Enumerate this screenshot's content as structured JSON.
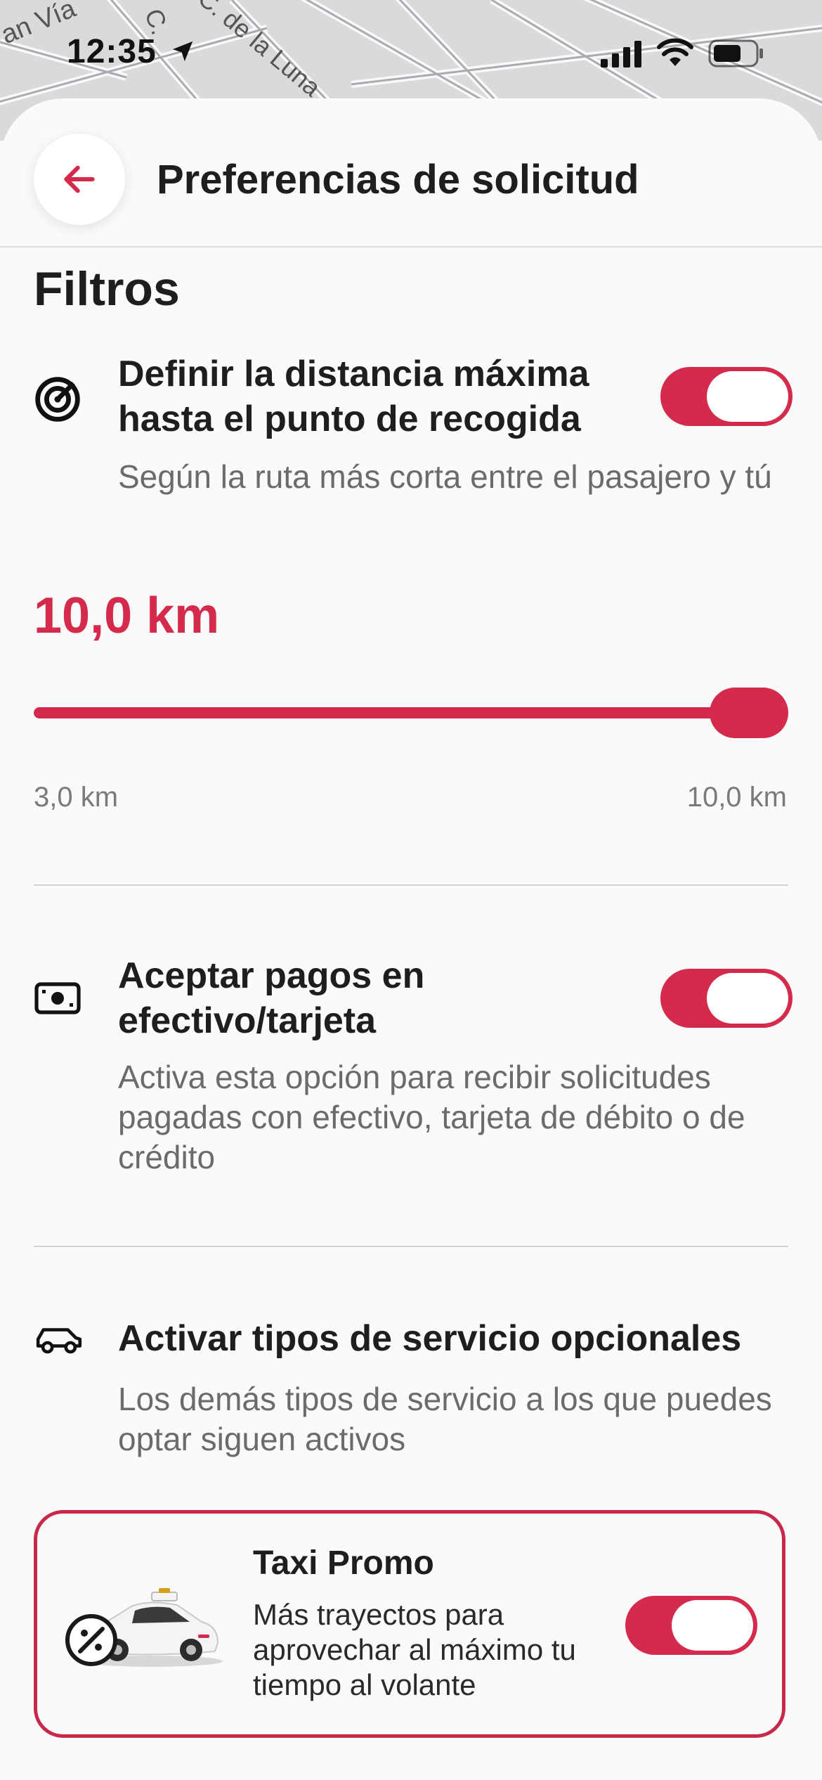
{
  "status_bar": {
    "time": "12:35",
    "icons": [
      "location-arrow-icon",
      "cellular-signal-icon",
      "wifi-icon",
      "battery-icon"
    ]
  },
  "map": {
    "street_labels": [
      "an Vía",
      "C.",
      "C. de la Luna"
    ]
  },
  "header": {
    "title": "Preferencias de solicitud",
    "back_icon": "arrow-left-icon"
  },
  "filters": {
    "section_title": "Filtros",
    "max_distance": {
      "icon": "target-icon",
      "title": "Definir la distancia máxima hasta el punto de recogida",
      "description": "Según la ruta más corta entre el pasajero y tú",
      "toggle_on": true,
      "value_label": "10,0 km",
      "value_km": 10.0,
      "min_label": "3,0 km",
      "max_label": "10,0 km"
    },
    "payments": {
      "icon": "cash-icon",
      "title": "Aceptar pagos en efectivo/tarjeta",
      "description": "Activa esta opción para recibir solicitudes pagadas con efectivo, tarjeta de débito o de crédito",
      "toggle_on": true
    },
    "optional_services": {
      "icon": "car-icon",
      "title": "Activar tipos de servicio opcionales",
      "description": "Los demás tipos de servicio a los que puedes optar siguen activos"
    },
    "taxi_promo": {
      "title": "Taxi Promo",
      "description": "Más trayectos para aprovechar al máximo tu tiempo al volante",
      "toggle_on": true,
      "icon": "taxi-promo-icon"
    }
  },
  "colors": {
    "accent": "#d42b4c",
    "text": "#1e1e1e",
    "muted": "#6b6b6b"
  }
}
